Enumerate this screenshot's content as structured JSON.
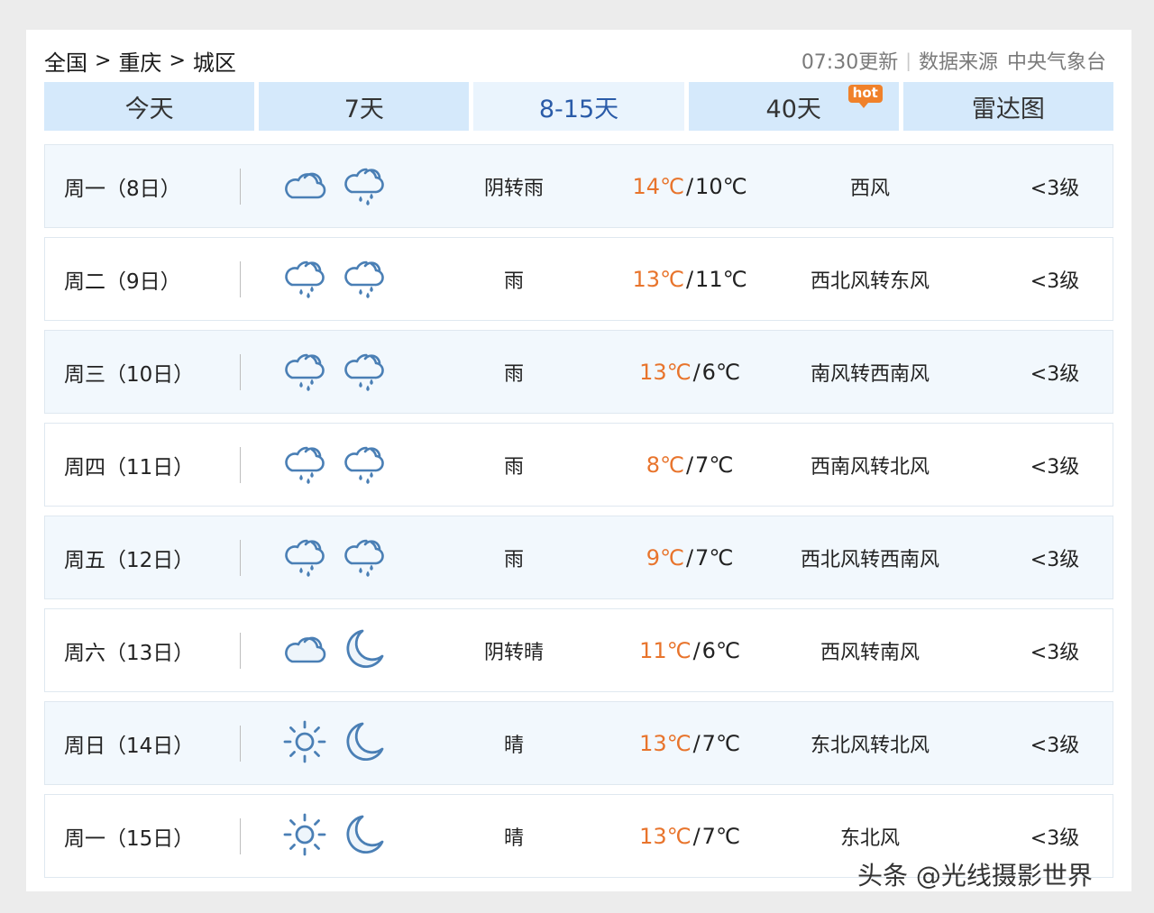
{
  "breadcrumb": {
    "level1": "全国",
    "level2": "重庆",
    "level3": "城区",
    "separator": ">"
  },
  "update": {
    "time_text": "07:30更新",
    "divider": "|",
    "source_label": "数据来源",
    "source_value": "中央气象台"
  },
  "tabs": [
    {
      "label": "今天",
      "active": false
    },
    {
      "label": "7天",
      "active": false
    },
    {
      "label": "8-15天",
      "active": true
    },
    {
      "label": "40天",
      "active": false,
      "badge": "hot"
    },
    {
      "label": "雷达图",
      "active": false
    }
  ],
  "forecast": [
    {
      "day": "周一（8日）",
      "icon_day": "cloudy-icon",
      "icon_night": "rain-icon",
      "desc": "阴转雨",
      "high": "14℃",
      "low": "10℃",
      "wind": "西风",
      "level": "<3级"
    },
    {
      "day": "周二（9日）",
      "icon_day": "rain-icon",
      "icon_night": "rain-icon",
      "desc": "雨",
      "high": "13℃",
      "low": "11℃",
      "wind": "西北风转东风",
      "level": "<3级"
    },
    {
      "day": "周三（10日）",
      "icon_day": "rain-icon",
      "icon_night": "rain-icon",
      "desc": "雨",
      "high": "13℃",
      "low": "6℃",
      "wind": "南风转西南风",
      "level": "<3级"
    },
    {
      "day": "周四（11日）",
      "icon_day": "rain-icon",
      "icon_night": "rain-icon",
      "desc": "雨",
      "high": "8℃",
      "low": "7℃",
      "wind": "西南风转北风",
      "level": "<3级"
    },
    {
      "day": "周五（12日）",
      "icon_day": "rain-icon",
      "icon_night": "rain-icon",
      "desc": "雨",
      "high": "9℃",
      "low": "7℃",
      "wind": "西北风转西南风",
      "level": "<3级"
    },
    {
      "day": "周六（13日）",
      "icon_day": "cloudy-icon",
      "icon_night": "moon-icon",
      "desc": "阴转晴",
      "high": "11℃",
      "low": "6℃",
      "wind": "西风转南风",
      "level": "<3级"
    },
    {
      "day": "周日（14日）",
      "icon_day": "sun-icon",
      "icon_night": "moon-icon",
      "desc": "晴",
      "high": "13℃",
      "low": "7℃",
      "wind": "东北风转北风",
      "level": "<3级"
    },
    {
      "day": "周一（15日）",
      "icon_day": "sun-icon",
      "icon_night": "moon-icon",
      "desc": "晴",
      "high": "13℃",
      "low": "7℃",
      "wind": "东北风",
      "level": "<3级"
    }
  ],
  "temp_separator": "/",
  "watermark": "头条 @光线摄影世界",
  "colors": {
    "accent_high_temp": "#e8742c",
    "tab_bg": "#d5e9fb",
    "tab_active_bg": "#eaf4fd",
    "tab_active_text": "#2a5ba8",
    "icon_stroke": "#4a7fb5"
  }
}
